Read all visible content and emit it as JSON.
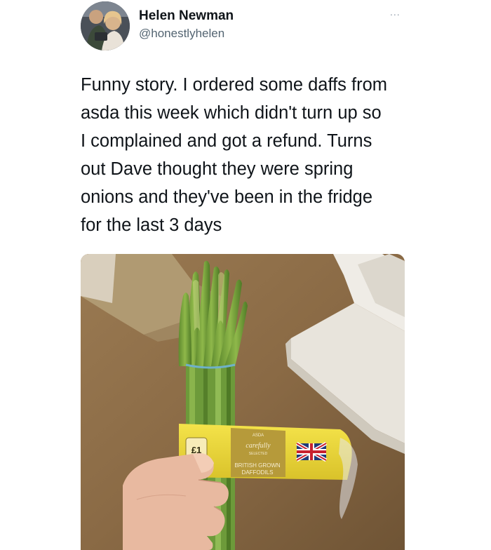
{
  "tweet": {
    "author_name": "Helen Newman",
    "author_handle": "@honestlyhelen",
    "more_label": "...",
    "text": "Funny story. I ordered some daffs from\nasda this week which didn't turn up so\nI complained and got a refund. Turns\nout Dave thought they were spring\nonions and they've been in the fridge\nfor the last 3 days"
  },
  "photo_label": {
    "price_tag": "£1",
    "brand": "ASDA",
    "range": "carefully",
    "range_sub": "SELECTED",
    "product_line1": "BRITISH GROWN",
    "product_line2": "DAFFODILS"
  },
  "icons": {
    "more": "more-options-icon",
    "flag": "union-jack-flag-icon"
  }
}
